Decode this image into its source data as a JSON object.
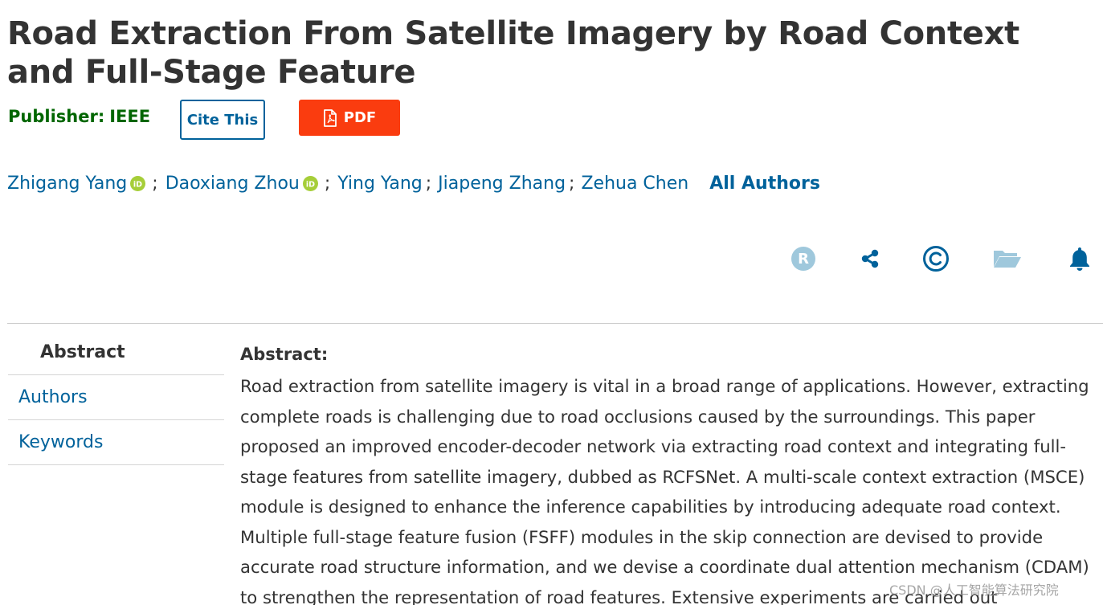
{
  "title": "Road Extraction From Satellite Imagery by Road Context and Full-Stage Feature",
  "publisher": {
    "label": "Publisher:",
    "value": "IEEE"
  },
  "buttons": {
    "cite": "Cite This",
    "pdf": "PDF"
  },
  "authors": [
    {
      "name": "Zhigang Yang",
      "orcid": true
    },
    {
      "name": "Daoxiang Zhou",
      "orcid": true
    },
    {
      "name": "Ying Yang",
      "orcid": false
    },
    {
      "name": "Jiapeng Zhang",
      "orcid": false
    },
    {
      "name": "Zehua Chen",
      "orcid": false
    }
  ],
  "separator": ";",
  "all_authors": "All Authors",
  "toolbar": {
    "icons": [
      "rights-icon",
      "share-icon",
      "copyright-icon",
      "folder-icon",
      "bell-icon"
    ],
    "icon_r_letter": "R",
    "icon_c_letter": "©"
  },
  "nav": {
    "items": [
      {
        "label": "Abstract",
        "active": true
      },
      {
        "label": "Authors",
        "active": false
      },
      {
        "label": "Keywords",
        "active": false
      }
    ]
  },
  "abstract": {
    "heading": "Abstract:",
    "text": "Road extraction from satellite imagery is vital in a broad range of applications. However, extracting complete roads is challenging due to road occlusions caused by the surroundings. This paper proposed an improved encoder-decoder network via extracting road context and integrating full-stage features from satellite imagery, dubbed as RCFSNet. A multi-scale context extraction (MSCE) module is designed to enhance the inference capabilities by introducing adequate road context. Multiple full-stage feature fusion (FSFF) modules in the skip connection are devised to provide accurate road structure information, and we devise a coordinate dual attention mechanism (CDAM) to strengthen the representation of road features. Extensive experiments are carried out"
  },
  "watermark": "CSDN @人工智能算法研究院",
  "colors": {
    "link": "#00629b",
    "publisher": "#006600",
    "pdf_button": "#fa3c0f",
    "text": "#333333",
    "orcid": "#a6ce39"
  }
}
